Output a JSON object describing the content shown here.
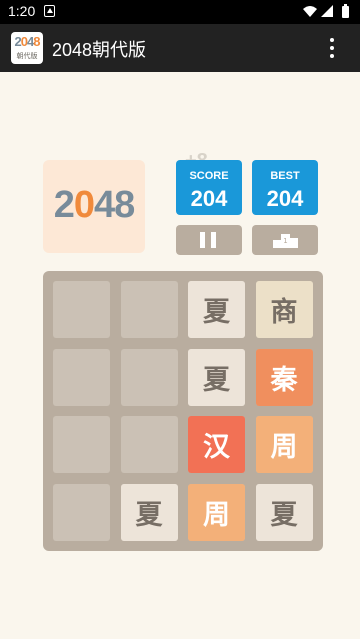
{
  "status_bar": {
    "time": "1:20"
  },
  "app_bar": {
    "logo": {
      "digits": "2048",
      "caption": "朝代版"
    },
    "title": "2048朝代版"
  },
  "header": {
    "logo_digits": [
      "2",
      "0",
      "4",
      "8"
    ],
    "score_popup": "+8",
    "score": {
      "label": "SCORE",
      "value": "204"
    },
    "best": {
      "label": "BEST",
      "value": "204"
    }
  },
  "board": {
    "rows": [
      [
        "",
        "",
        "夏",
        "商"
      ],
      [
        "",
        "",
        "夏",
        "秦"
      ],
      [
        "",
        "",
        "汉",
        "周"
      ],
      [
        "",
        "夏",
        "周",
        "夏"
      ]
    ]
  },
  "colors": {
    "background": "#faf6ed",
    "board": "#b9ad9f",
    "empty_cell": "#cbc1b5",
    "score_box": "#1a98d9",
    "tile_夏": "#ede4d9",
    "tile_商": "#ece0c8",
    "tile_秦": "#f08f5e",
    "tile_汉": "#f27155",
    "tile_周": "#f3b079"
  }
}
